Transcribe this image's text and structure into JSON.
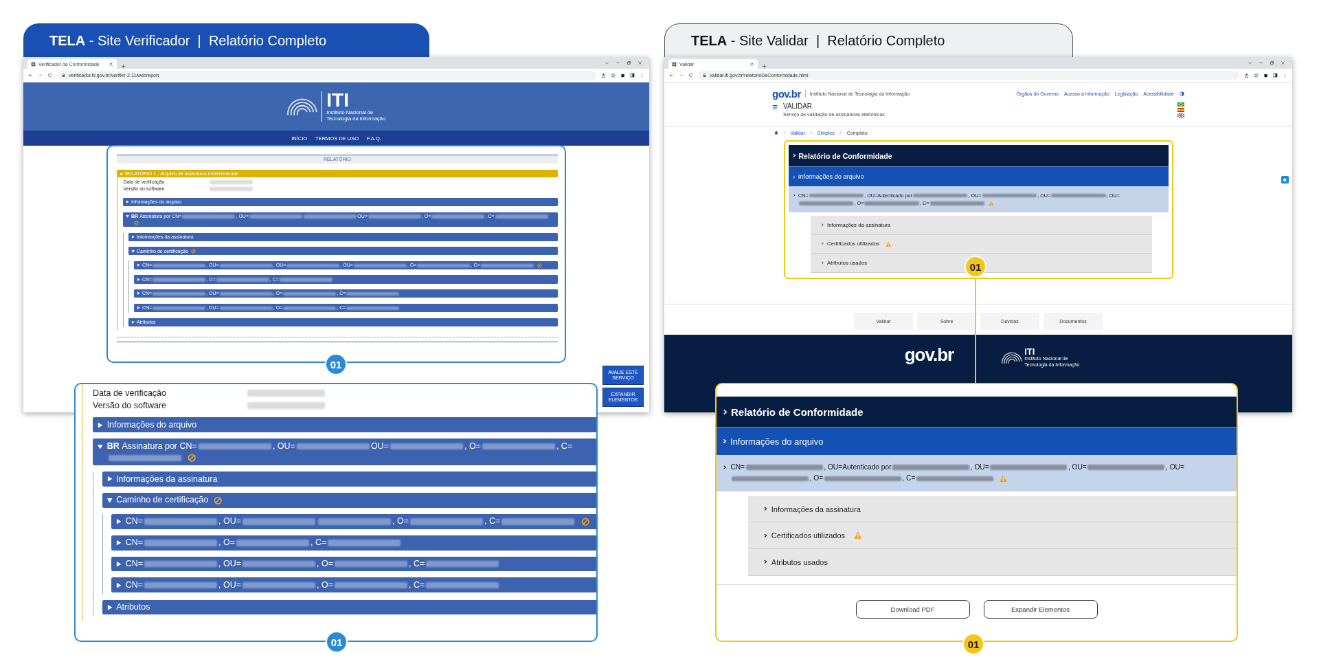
{
  "left": {
    "header": {
      "title": "**TELA** - Site Verificador  |  Relatório Completo"
    },
    "browser": {
      "tab_title": "Verificador de Conformidade",
      "url": "verificador.iti.gov.br/verifier-2.11/webreport"
    },
    "site_header": {
      "logo": "ITI",
      "caption": [
        "Instituto Nacional de",
        "Tecnologia da Informação"
      ]
    },
    "nav": [
      "INÍCIO",
      "TERMOS DE USO",
      "F.A.Q."
    ],
    "report": {
      "title": "RELATÓRIO",
      "section": {
        "label": "RELATÓRIO 1 - Arquivo de assinatura indeterminado",
        "expanded": true
      },
      "fields": [
        "Data de verificação",
        "Versão do software"
      ],
      "items": [
        {
          "segments": [
            {
              "kind": "text",
              "text": "Informações do arquivo"
            }
          ],
          "expanded": false,
          "alert": false
        },
        {
          "badge": "BR",
          "segments": [
            {
              "kind": "text",
              "text": "Assinatura por CN="
            },
            {
              "kind": "blur"
            },
            {
              "kind": "text",
              "text": ", OU="
            },
            {
              "kind": "blur"
            },
            {
              "kind": "blur"
            },
            {
              "kind": "text",
              "text": "OU="
            },
            {
              "kind": "blur"
            },
            {
              "kind": "text",
              "text": ", O="
            },
            {
              "kind": "blur"
            },
            {
              "kind": "text",
              "text": ", C="
            },
            {
              "kind": "blur"
            }
          ],
          "expanded": true,
          "alert": true,
          "children": [
            {
              "segments": [
                {
                  "kind": "text",
                  "text": "Informações da assinatura"
                }
              ],
              "expanded": false,
              "alert": false
            },
            {
              "segments": [
                {
                  "kind": "text",
                  "text": "Caminho de certificação"
                }
              ],
              "expanded": true,
              "alert": true,
              "children": [
                {
                  "segments": [
                    {
                      "kind": "text",
                      "text": "CN="
                    },
                    {
                      "kind": "blur"
                    },
                    {
                      "kind": "text",
                      "text": ", OU="
                    },
                    {
                      "kind": "blur"
                    },
                    {
                      "kind": "text",
                      "text": ", OU="
                    },
                    {
                      "kind": "blur"
                    },
                    {
                      "kind": "text",
                      "text": ", OU="
                    },
                    {
                      "kind": "blur"
                    },
                    {
                      "kind": "text",
                      "text": ", O="
                    },
                    {
                      "kind": "blur"
                    },
                    {
                      "kind": "text",
                      "text": ", C="
                    },
                    {
                      "kind": "blur"
                    }
                  ],
                  "expanded": false,
                  "alert": true
                },
                {
                  "segments": [
                    {
                      "kind": "text",
                      "text": "CN="
                    },
                    {
                      "kind": "blur"
                    },
                    {
                      "kind": "text",
                      "text": ", O="
                    },
                    {
                      "kind": "blur"
                    },
                    {
                      "kind": "text",
                      "text": ", C="
                    },
                    {
                      "kind": "blur"
                    }
                  ],
                  "expanded": false,
                  "alert": false
                },
                {
                  "segments": [
                    {
                      "kind": "text",
                      "text": "CN="
                    },
                    {
                      "kind": "blur"
                    },
                    {
                      "kind": "text",
                      "text": ", OU="
                    },
                    {
                      "kind": "blur"
                    },
                    {
                      "kind": "text",
                      "text": ", O="
                    },
                    {
                      "kind": "blur"
                    },
                    {
                      "kind": "text",
                      "text": ", C="
                    },
                    {
                      "kind": "blur"
                    }
                  ],
                  "expanded": false,
                  "alert": false
                },
                {
                  "segments": [
                    {
                      "kind": "text",
                      "text": "CN="
                    },
                    {
                      "kind": "blur"
                    },
                    {
                      "kind": "text",
                      "text": ", OU="
                    },
                    {
                      "kind": "blur"
                    },
                    {
                      "kind": "text",
                      "text": ", O="
                    },
                    {
                      "kind": "blur"
                    },
                    {
                      "kind": "text",
                      "text": ", C="
                    },
                    {
                      "kind": "blur"
                    }
                  ],
                  "expanded": false,
                  "alert": false
                }
              ]
            },
            {
              "segments": [
                {
                  "kind": "text",
                  "text": "Atributos"
                }
              ],
              "expanded": false,
              "alert": false
            }
          ]
        }
      ]
    },
    "side_buttons": [
      "AVALIE ESTE SERVIÇO",
      "EXPANDIR ELEMENTOS"
    ],
    "callout": "01",
    "zoom_inset": {
      "fields": [
        "Data de verificação",
        "Versão do software"
      ],
      "items": [
        {
          "segments": [
            {
              "kind": "text",
              "text": "Informações do arquivo"
            }
          ],
          "expanded": false,
          "alert": false
        },
        {
          "badge": "BR",
          "segments": [
            {
              "kind": "text",
              "text": "Assinatura por CN="
            },
            {
              "kind": "blur"
            },
            {
              "kind": "text",
              "text": ", OU="
            },
            {
              "kind": "blur"
            },
            {
              "kind": "text",
              "text": "OU="
            },
            {
              "kind": "blur"
            },
            {
              "kind": "text",
              "text": ", O="
            },
            {
              "kind": "blur"
            },
            {
              "kind": "text",
              "text": ", C="
            },
            {
              "kind": "blur"
            }
          ],
          "expanded": true,
          "alert": true,
          "children": [
            {
              "segments": [
                {
                  "kind": "text",
                  "text": "Informações da assinatura"
                }
              ],
              "expanded": false,
              "alert": false
            },
            {
              "segments": [
                {
                  "kind": "text",
                  "text": "Caminho de certificação"
                }
              ],
              "expanded": true,
              "alert": true,
              "children": [
                {
                  "segments": [
                    {
                      "kind": "text",
                      "text": "CN="
                    },
                    {
                      "kind": "blur"
                    },
                    {
                      "kind": "text",
                      "text": ", OU="
                    },
                    {
                      "kind": "blur"
                    },
                    {
                      "kind": "blur"
                    },
                    {
                      "kind": "text",
                      "text": ", O="
                    },
                    {
                      "kind": "blur"
                    },
                    {
                      "kind": "text",
                      "text": ", C="
                    },
                    {
                      "kind": "blur"
                    }
                  ],
                  "expanded": false,
                  "alert": true
                },
                {
                  "segments": [
                    {
                      "kind": "text",
                      "text": "CN="
                    },
                    {
                      "kind": "blur"
                    },
                    {
                      "kind": "text",
                      "text": ", O="
                    },
                    {
                      "kind": "blur"
                    },
                    {
                      "kind": "text",
                      "text": ", C="
                    },
                    {
                      "kind": "blur"
                    }
                  ],
                  "expanded": false,
                  "alert": false
                },
                {
                  "segments": [
                    {
                      "kind": "text",
                      "text": "CN="
                    },
                    {
                      "kind": "blur"
                    },
                    {
                      "kind": "text",
                      "text": ", OU="
                    },
                    {
                      "kind": "blur"
                    },
                    {
                      "kind": "text",
                      "text": ", O="
                    },
                    {
                      "kind": "blur"
                    },
                    {
                      "kind": "text",
                      "text": ", C="
                    },
                    {
                      "kind": "blur"
                    }
                  ],
                  "expanded": false,
                  "alert": false
                },
                {
                  "segments": [
                    {
                      "kind": "text",
                      "text": "CN="
                    },
                    {
                      "kind": "blur"
                    },
                    {
                      "kind": "text",
                      "text": ", OU="
                    },
                    {
                      "kind": "blur"
                    },
                    {
                      "kind": "text",
                      "text": ", O="
                    },
                    {
                      "kind": "blur"
                    },
                    {
                      "kind": "text",
                      "text": ", C="
                    },
                    {
                      "kind": "blur"
                    }
                  ],
                  "expanded": false,
                  "alert": false
                }
              ]
            },
            {
              "segments": [
                {
                  "kind": "text",
                  "text": "Atributos"
                }
              ],
              "expanded": false,
              "alert": false
            }
          ]
        }
      ]
    },
    "zoom_callout": "01"
  },
  "right": {
    "header": {
      "title": "**TELA** - Site Validar  |  Relatório Completo"
    },
    "browser": {
      "tab_title": "Validar",
      "url": "validar.iti.gov.br/relatorioDeConformidade.html"
    },
    "site_header": {
      "logo": "gov.br",
      "institute": "Instituto Nacional de Tecnologia da Informação",
      "links": [
        "Órgãos do Governo",
        "Acesso à Informação",
        "Legislação",
        "Acessibilidade"
      ],
      "service": "VALIDAR",
      "service_subtitle": "Serviço de validação de assinaturas eletrônicas"
    },
    "breadcrumb": [
      {
        "label": "Validar",
        "current": false
      },
      {
        "label": "Simples",
        "current": false
      },
      {
        "label": "Completo",
        "current": true
      }
    ],
    "report": {
      "title": "Relatório de Conformidade",
      "file_info": "Informações do arquivo",
      "certificate": {
        "segments": [
          {
            "kind": "text",
            "text": "CN="
          },
          {
            "kind": "blur"
          },
          {
            "kind": "text",
            "text": ", OU=Autenticado por"
          },
          {
            "kind": "blur"
          },
          {
            "kind": "text",
            "text": ", OU="
          },
          {
            "kind": "blur"
          },
          {
            "kind": "text",
            "text": ", OU="
          },
          {
            "kind": "blur"
          },
          {
            "kind": "text",
            "text": ", OU="
          },
          {
            "kind": "blur"
          },
          {
            "kind": "text",
            "text": ", O="
          },
          {
            "kind": "blur"
          },
          {
            "kind": "text",
            "text": ", C="
          },
          {
            "kind": "blur"
          }
        ],
        "warning": true
      },
      "items": [
        {
          "label": "Informações da assinatura",
          "warning": false
        },
        {
          "label": "Certificados utilizados",
          "warning": true
        },
        {
          "label": "Atributos usados",
          "warning": false
        }
      ]
    },
    "callout": "01",
    "footer_links": [
      "Validar",
      "Sobre",
      "Dúvidas",
      "Documentos"
    ],
    "footer": {
      "logo": "gov.br",
      "iti_logo": "ITI",
      "iti_caption": [
        "Instituto Nacional de",
        "Tecnologia da Informação"
      ]
    },
    "zoom_inset": {
      "report": {
        "title": "Relatório de Conformidade",
        "file_info": "Informações do arquivo",
        "certificate": {
          "segments": [
            {
              "kind": "text",
              "text": "CN="
            },
            {
              "kind": "blur"
            },
            {
              "kind": "text",
              "text": ", OU=Autenticado por"
            },
            {
              "kind": "blur"
            },
            {
              "kind": "text",
              "text": ", OU="
            },
            {
              "kind": "blur"
            },
            {
              "kind": "text",
              "text": ", OU="
            },
            {
              "kind": "blur"
            },
            {
              "kind": "text",
              "text": ", OU="
            },
            {
              "kind": "blur"
            },
            {
              "kind": "text",
              "text": ", O="
            },
            {
              "kind": "blur"
            },
            {
              "kind": "text",
              "text": ", C="
            },
            {
              "kind": "blur"
            }
          ],
          "warning": true
        },
        "items": [
          {
            "label": "Informações da assinatura",
            "warning": false
          },
          {
            "label": "Certificados utilizados",
            "warning": true
          },
          {
            "label": "Atributos usados",
            "warning": false
          }
        ]
      },
      "buttons": [
        "Download PDF",
        "Expandir Elementos"
      ]
    },
    "zoom_callout": "01"
  }
}
